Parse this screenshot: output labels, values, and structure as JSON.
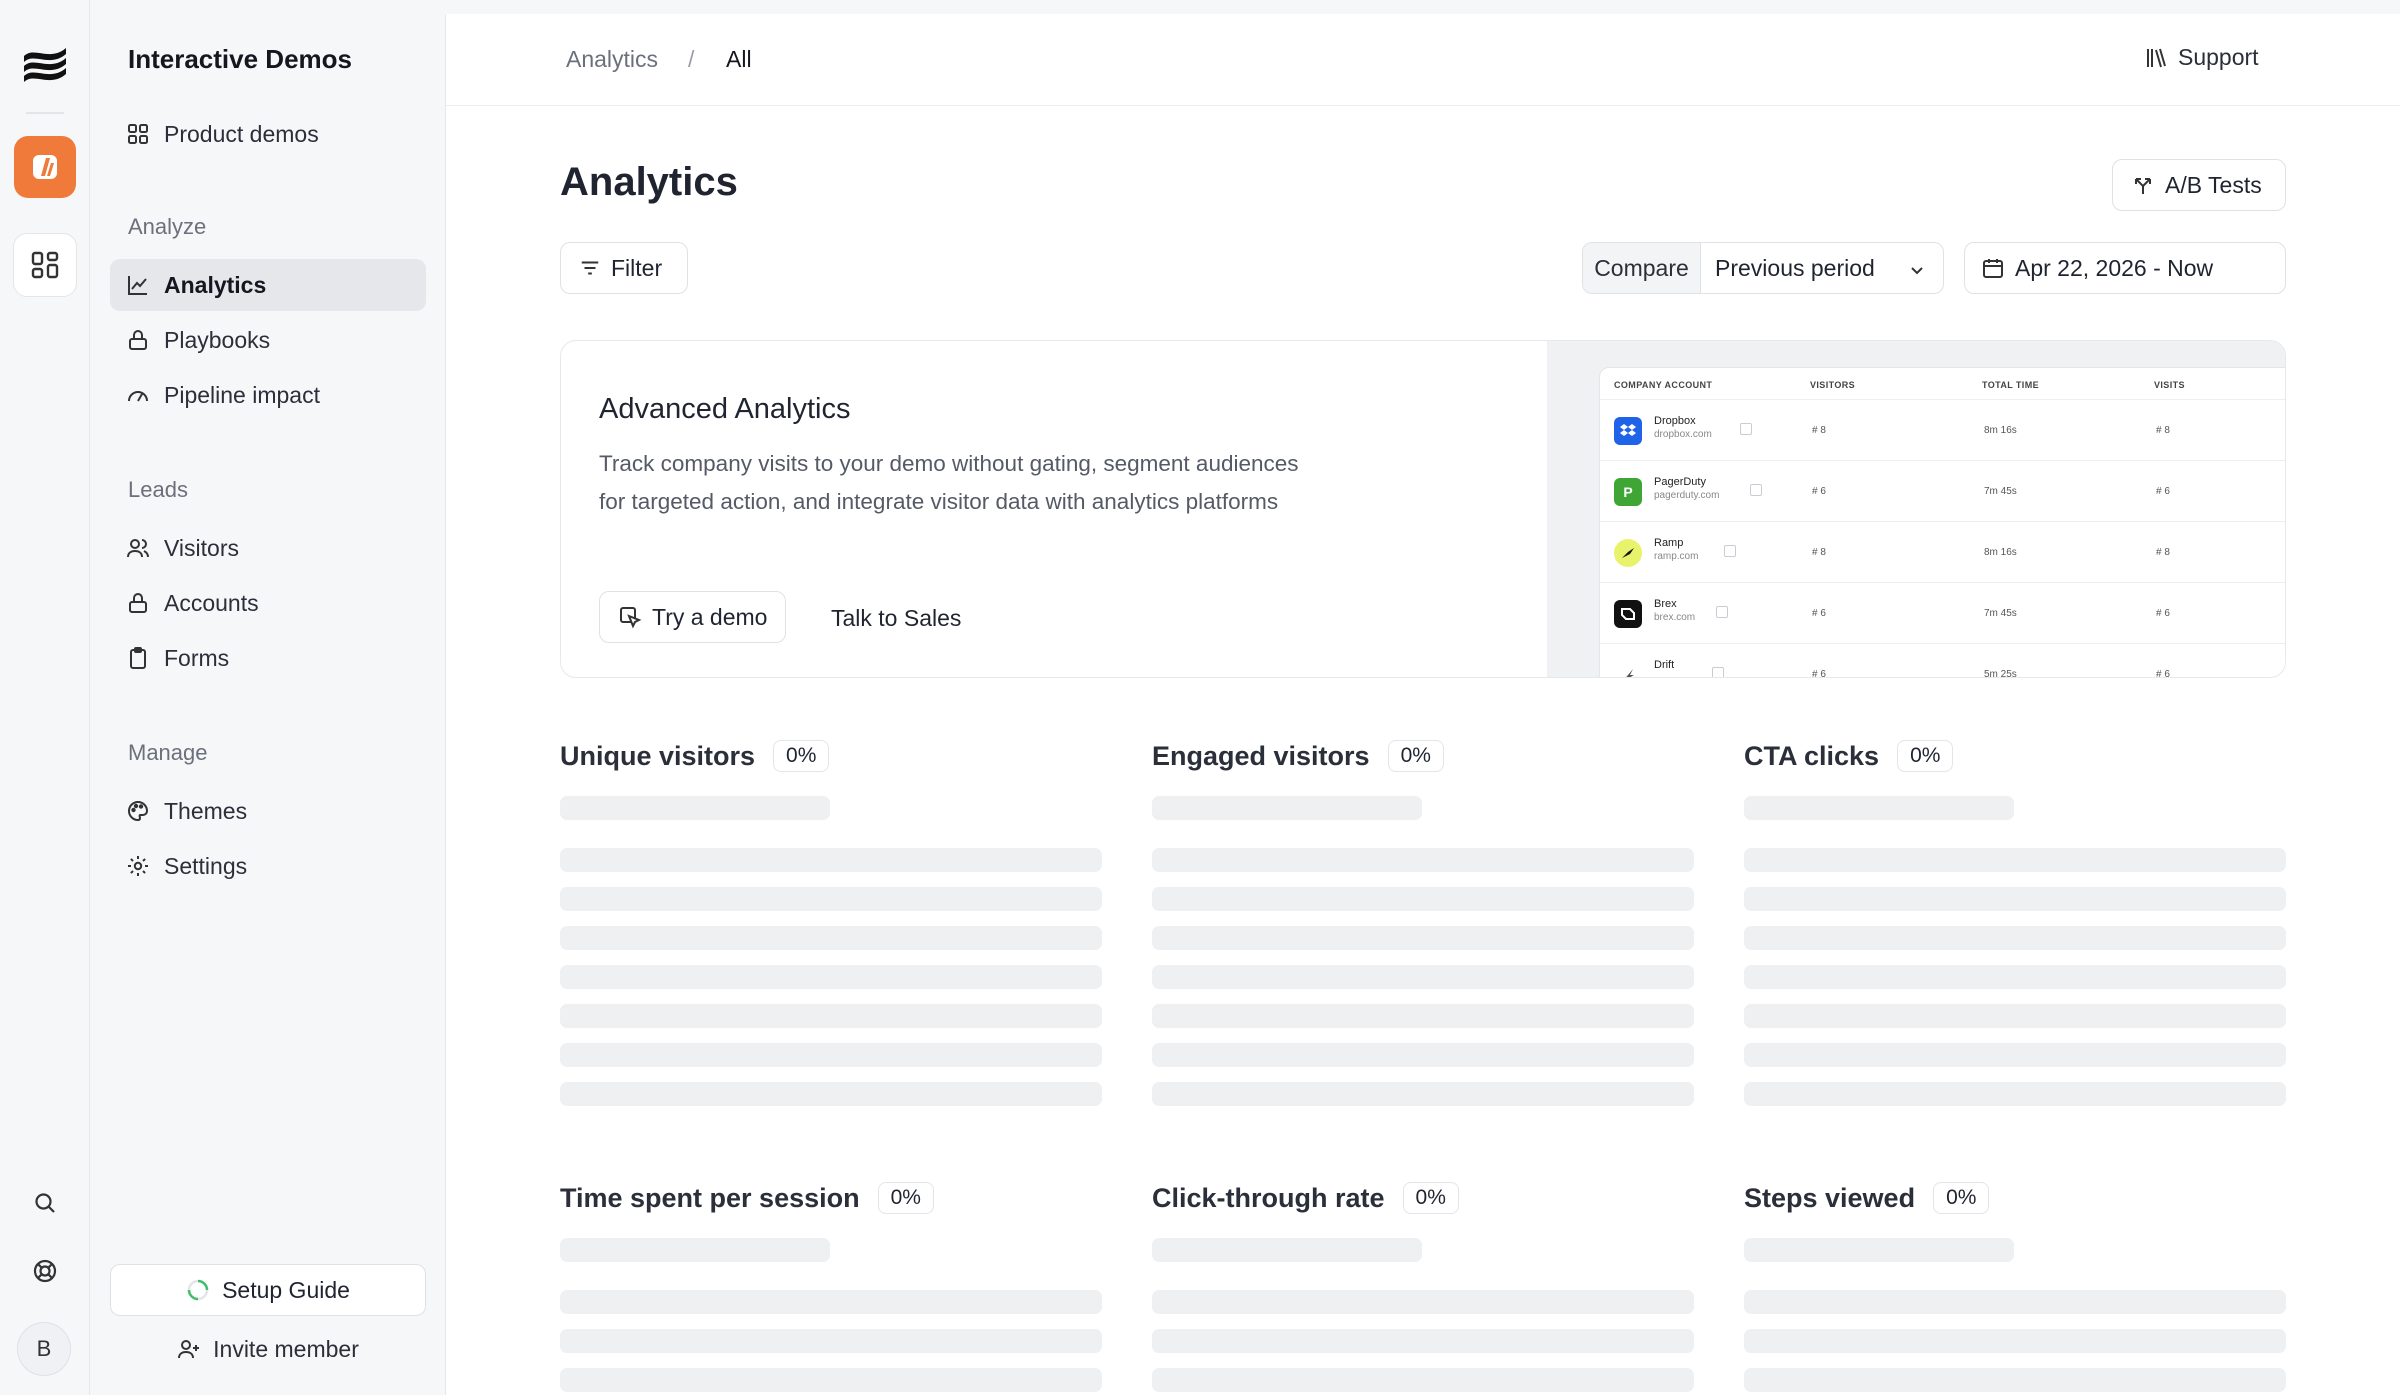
{
  "rail": {
    "avatar_initial": "B"
  },
  "sidebar": {
    "workspace_title": "Interactive Demos",
    "product_demos": "Product demos",
    "sections": {
      "analyze": "Analyze",
      "leads": "Leads",
      "manage": "Manage"
    },
    "analyze_items": [
      "Analytics",
      "Playbooks",
      "Pipeline impact"
    ],
    "leads_items": [
      "Visitors",
      "Accounts",
      "Forms"
    ],
    "manage_items": [
      "Themes",
      "Settings"
    ],
    "setup_guide": "Setup Guide",
    "invite_member": "Invite member"
  },
  "topbar": {
    "breadcrumb": [
      "Analytics",
      "All"
    ],
    "breadcrumb_sep": "/",
    "support": "Support"
  },
  "page": {
    "title": "Analytics",
    "ab_tests": "A/B Tests",
    "filter": "Filter",
    "compare_label": "Compare",
    "compare_value": "Previous period",
    "date_range": "Apr 22, 2026 - Now"
  },
  "promo": {
    "title": "Advanced Analytics",
    "description_line1": "Track company visits to your demo without gating, segment audiences",
    "description_line2": "for targeted action, and integrate visitor data with analytics platforms",
    "try_demo": "Try a demo",
    "talk_to_sales": "Talk to Sales",
    "preview": {
      "headers": [
        "COMPANY ACCOUNT",
        "VISITORS",
        "TOTAL TIME",
        "VISITS"
      ],
      "rows": [
        {
          "name": "Dropbox",
          "domain": "dropbox.com",
          "visitors": "# 8",
          "time": "8m 16s",
          "visits": "# 8",
          "color": "#1f63e8"
        },
        {
          "name": "PagerDuty",
          "domain": "pagerduty.com",
          "visitors": "# 6",
          "time": "7m 45s",
          "visits": "# 6",
          "color": "#3fa535"
        },
        {
          "name": "Ramp",
          "domain": "ramp.com",
          "visitors": "# 8",
          "time": "8m 16s",
          "visits": "# 8",
          "color": "#e8f26a"
        },
        {
          "name": "Brex",
          "domain": "brex.com",
          "visitors": "# 6",
          "time": "7m 45s",
          "visits": "# 6",
          "color": "#111111"
        },
        {
          "name": "Drift",
          "domain": "",
          "visitors": "# 6",
          "time": "5m 25s",
          "visits": "# 6",
          "color": "#ffffff"
        }
      ]
    }
  },
  "metrics": [
    {
      "title": "Unique visitors",
      "change": "0%"
    },
    {
      "title": "Engaged visitors",
      "change": "0%"
    },
    {
      "title": "CTA clicks",
      "change": "0%"
    },
    {
      "title": "Time spent per session",
      "change": "0%"
    },
    {
      "title": "Click-through rate",
      "change": "0%"
    },
    {
      "title": "Steps viewed",
      "change": "0%"
    }
  ],
  "colors": {
    "accent_orange": "#f07a3a",
    "active_nav_bg": "#e6e7ea",
    "skeleton": "#eef0f2"
  }
}
